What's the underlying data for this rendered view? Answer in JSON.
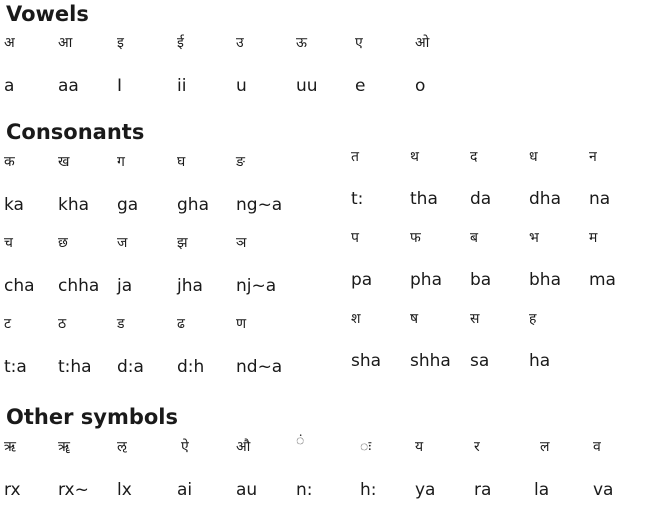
{
  "vowels": {
    "heading": "Vowels",
    "dev": [
      "अ",
      "आ",
      "इ",
      "ई",
      "उ",
      "ऊ",
      "ए",
      "ओ"
    ],
    "lat": [
      "a",
      "aa",
      "I",
      "ii",
      "u",
      "uu",
      "e",
      "o"
    ]
  },
  "consonants": {
    "heading": "Consonants",
    "left": {
      "dev": [
        [
          "क",
          "ख",
          "ग",
          "घ",
          "ङ"
        ],
        [
          "च",
          "छ",
          "ज",
          "झ",
          "ञ"
        ],
        [
          "ट",
          "ठ",
          "ड",
          "ढ",
          "ण"
        ]
      ],
      "lat": [
        [
          "ka",
          "kha",
          "ga",
          "gha",
          "ng~a"
        ],
        [
          "cha",
          "chha",
          "ja",
          "jha",
          "nj~a"
        ],
        [
          "t:a",
          "t:ha",
          "d:a",
          "d:h",
          "nd~a"
        ]
      ]
    },
    "right": {
      "dev": [
        [
          "त",
          "थ",
          "द",
          "ध",
          "न"
        ],
        [
          "प",
          "फ",
          "ब",
          "भ",
          "म"
        ],
        [
          "श",
          "ष",
          "स",
          "ह"
        ]
      ],
      "lat": [
        [
          "t:",
          "tha",
          "da",
          "dha",
          "na"
        ],
        [
          "pa",
          "pha",
          "ba",
          "bha",
          "ma"
        ],
        [
          "sha",
          "shha",
          "sa",
          "ha"
        ]
      ]
    }
  },
  "other": {
    "heading": "Other symbols",
    "dev": [
      "ऋ",
      "ॠ",
      "ऌ",
      "ऐ",
      "औ",
      "ं",
      "ः",
      "य",
      "र",
      "ल",
      "व"
    ],
    "lat": [
      "rx",
      "rx~",
      "lx",
      "ai",
      "au",
      "n:",
      "h:",
      "ya",
      "ra",
      "la",
      "va"
    ]
  }
}
